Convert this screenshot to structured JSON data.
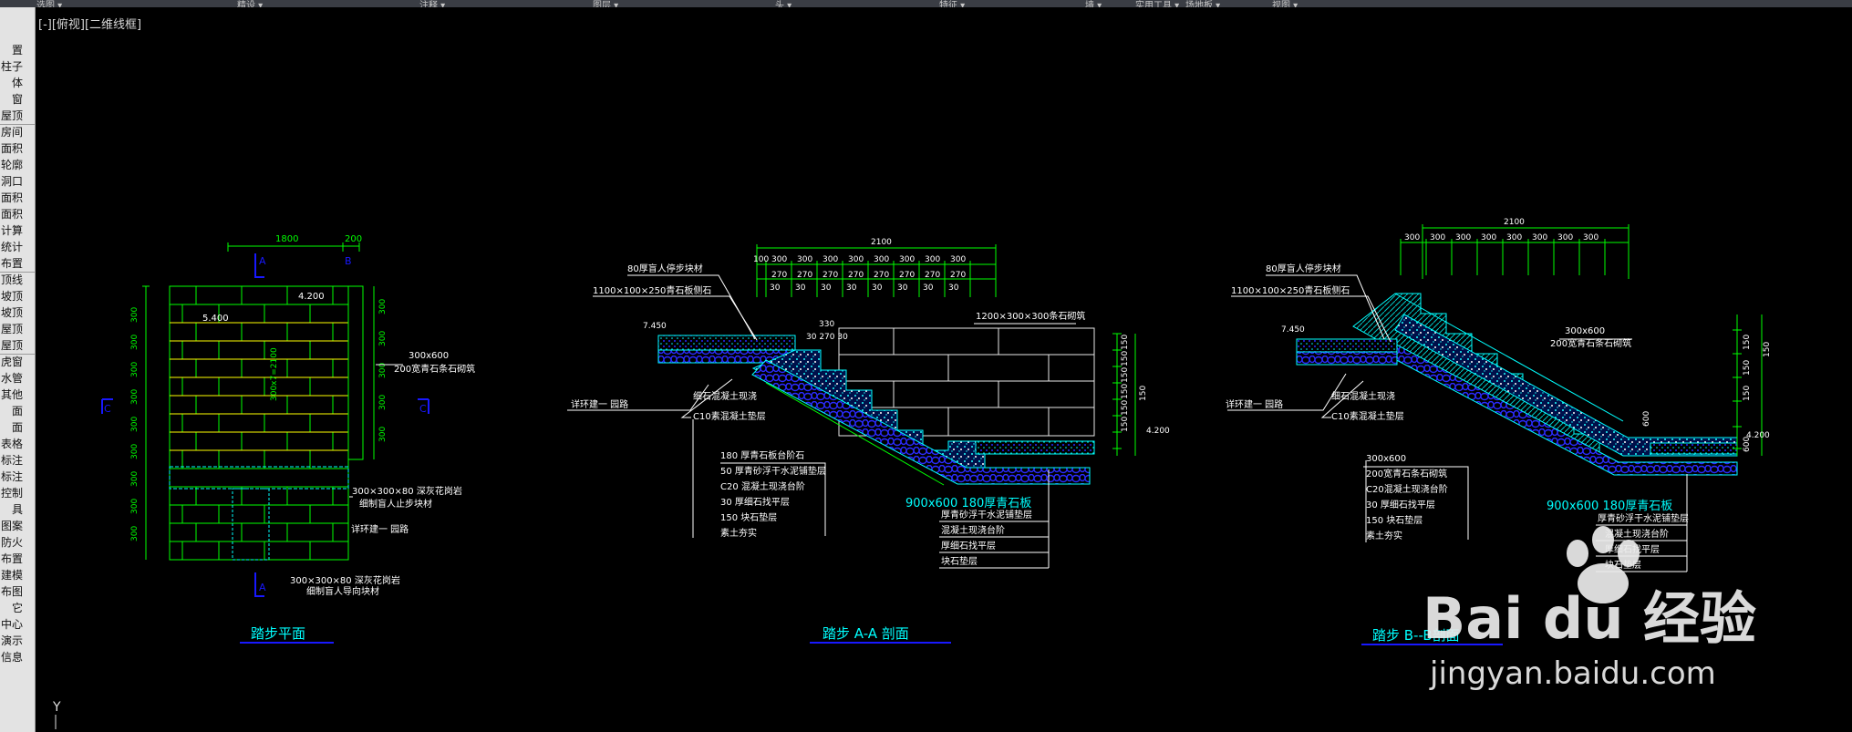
{
  "menubar": {
    "items": [
      "选图 ▾",
      "精设 ▾",
      "注释 ▾",
      "图层 ▾",
      "头 ▾",
      "特征 ▾",
      "墙 ▾",
      "实用工具 ▾",
      "场地板 ▾",
      "视图 ▾"
    ]
  },
  "sidebar": {
    "items": [
      "置",
      "柱子",
      "体",
      "窗",
      "屋顶",
      "房间",
      "面积",
      "轮廓",
      "洞口",
      "面积",
      "面积",
      "计算",
      "统计",
      "布置",
      "顶线",
      "坡顶",
      "坡顶",
      "屋顶",
      "屋顶",
      "虎窗",
      "水管",
      "其他",
      "面",
      "面",
      "表格",
      "标注",
      "标注",
      "控制",
      "具",
      "图案",
      "防火",
      "布置",
      "建模",
      "布图",
      "它",
      "中心",
      "演示",
      "信息"
    ]
  },
  "viewport": {
    "label": "[-][俯视][二维线框]"
  },
  "colors": {
    "background": "#000000",
    "green": "#00ff00",
    "white": "#e8e8e8",
    "cyan": "#00ffff",
    "blue": "#1818ff",
    "yellow": "#ffff00"
  },
  "drawing": {
    "plan": {
      "title": "踏步平面",
      "dim_top": [
        "1800",
        "200"
      ],
      "elev_upper": "4.200",
      "elev_lower": "5.400",
      "left_dims": [
        "300",
        "300",
        "300",
        "300",
        "300",
        "300",
        "300",
        "300",
        "300",
        "300",
        "300"
      ],
      "right_dims": [
        "300",
        "300",
        "300",
        "300",
        "300"
      ],
      "center_dim": "300x7=2100",
      "note_a": "300x600",
      "note_b": "200宽青石条石砌筑",
      "note_c": "300×300×80 深灰花岗岩",
      "note_d": "细制盲人止步块材",
      "note_e": "详环建一  园路",
      "note_f": "300×300×80 深灰花岗岩",
      "note_g": "细制盲人导向块材",
      "tag_a": "A",
      "tag_c": "C",
      "tag_b": "B"
    },
    "section_aa": {
      "title": "踏步 A-A 剖面",
      "dim_total": "2100",
      "dims_300": [
        "100",
        "300",
        "300",
        "300",
        "300",
        "300",
        "300",
        "300",
        "300"
      ],
      "dims_270": [
        "270",
        "270",
        "270",
        "270",
        "270",
        "270",
        "270",
        "270"
      ],
      "dims_30": [
        "30",
        "30",
        "30",
        "30",
        "30",
        "30",
        "30",
        "30"
      ],
      "dim_330": "330",
      "dim_30_270": "30 270 30",
      "elev_top": "7.450",
      "elev_bottom": "4.200",
      "right_dims": [
        "150",
        "150",
        "150",
        "150",
        "150",
        "150",
        "150"
      ],
      "note_stone": "1200×300×300条石砌筑",
      "label_1": "80厚盲人停步块材",
      "label_2": "1100×100×250青石板侧石",
      "label_3": "详环建一  园路",
      "label_4": "细石混凝土现浇",
      "label_5": "C10素混凝土垫层",
      "layers_left": [
        "180 厚青石板台阶石",
        "50 厚青砂浮干水泥铺垫层",
        "C20 混凝土现浇台阶",
        "30 厚细石找平层",
        "150 块石垫层",
        "素土夯实"
      ],
      "spec": "900x600 180厚青石板",
      "layers_right": [
        "厚青砂浮干水泥铺垫层",
        "混凝土现浇台阶",
        "厚细石找平层",
        "块石垫层"
      ]
    },
    "section_bb": {
      "title": "踏步  B--B剖面",
      "dim_total": "2100",
      "dims_300": [
        "300",
        "300",
        "300",
        "300",
        "300",
        "300",
        "300",
        "300"
      ],
      "elev_top": "7.450",
      "elev_bottom": "4.200",
      "right_dims": [
        "150",
        "150",
        "150",
        "150",
        "600"
      ],
      "label_1": "80厚盲人停步块材",
      "label_2": "1100×100×250青石板侧石",
      "label_3": "详环建一  园路",
      "label_4": "细石混凝土现浇",
      "label_5": "C10素混凝土垫层",
      "label_mid_a": "300x600",
      "label_mid_b": "200宽青石条石砌筑",
      "layers_left": [
        "300x600",
        "200宽青石条石砌筑",
        "C20混凝土现浇台阶",
        "30 厚细石找平层",
        "150 块石垫层",
        "素土夯实"
      ],
      "spec": "900x600 180厚青石板",
      "layers_right": [
        "厚青砂浮干水泥铺垫层",
        "混凝土现浇台阶",
        "厚细石找平层",
        "块石垫层"
      ],
      "dim_600": "600"
    },
    "ucs_label": "Y"
  },
  "watermark": {
    "brand": "Bai du 经验",
    "url": "jingyan.baidu.com"
  }
}
